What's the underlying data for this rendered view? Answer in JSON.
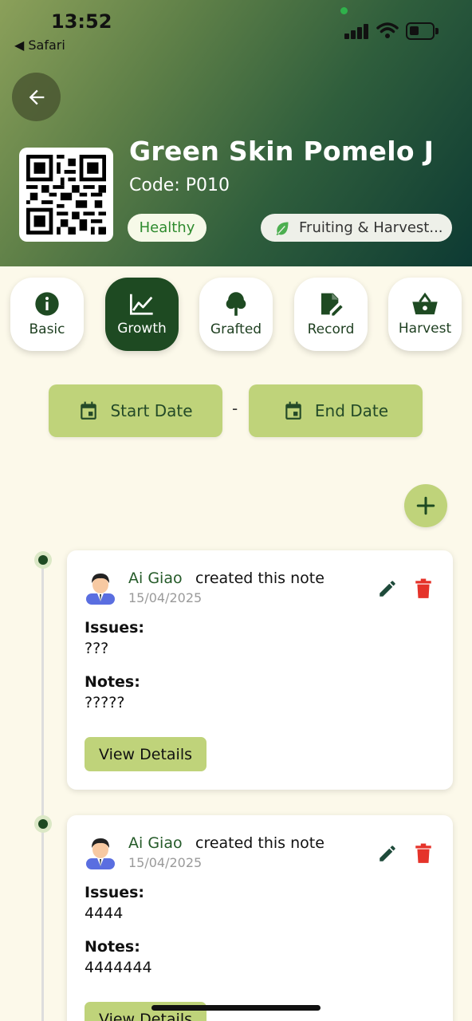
{
  "status_bar": {
    "time": "13:52",
    "back_app": "◀ Safari"
  },
  "plant": {
    "name": "Green Skin Pomelo J",
    "code": "Code: P010",
    "health": "Healthy",
    "stage": "Fruiting & Harvest..."
  },
  "tabs": [
    {
      "label": "Basic",
      "icon": "info-icon",
      "active": false
    },
    {
      "label": "Growth",
      "icon": "chart-icon",
      "active": true
    },
    {
      "label": "Grafted",
      "icon": "tree-icon",
      "active": false
    },
    {
      "label": "Record",
      "icon": "edit-note-icon",
      "active": false
    },
    {
      "label": "Harvest",
      "icon": "basket-icon",
      "active": false
    }
  ],
  "filters": {
    "start_label": "Start Date",
    "separator": "-",
    "end_label": "End Date"
  },
  "notes": [
    {
      "author": "Ai Giao",
      "action": "created this note",
      "date": "15/04/2025",
      "issues_label": "Issues:",
      "issues": "???",
      "notes_label": "Notes:",
      "notes": "?????",
      "button": "View Details"
    },
    {
      "author": "Ai Giao",
      "action": "created this note",
      "date": "15/04/2025",
      "issues_label": "Issues:",
      "issues": "4444",
      "notes_label": "Notes:",
      "notes": "4444444",
      "button": "View Details"
    }
  ],
  "colors": {
    "primary_dark": "#1e4a22",
    "accent_light": "#bfd37a",
    "background": "#fcf9ea",
    "delete": "#e5332a"
  }
}
